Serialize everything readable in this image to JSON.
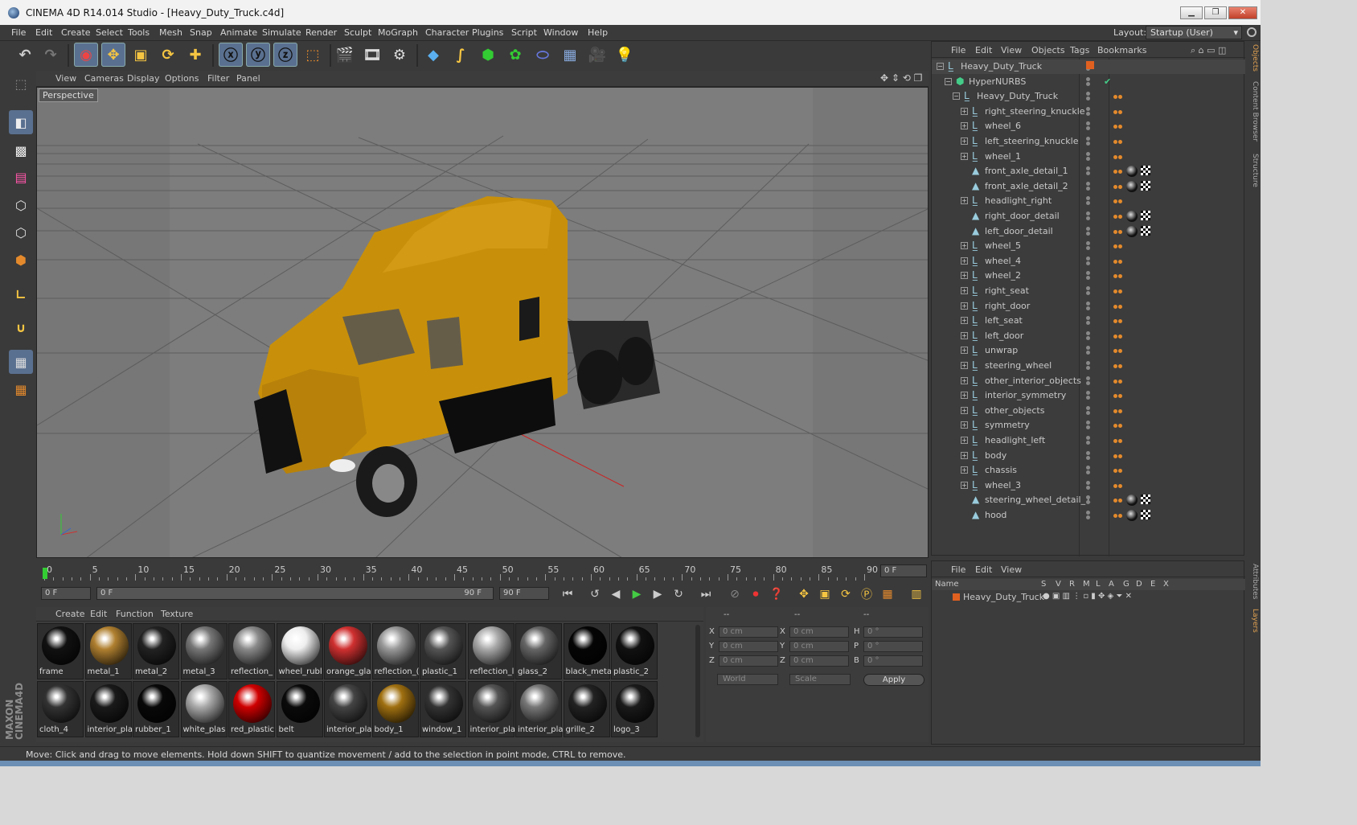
{
  "window": {
    "title": "CINEMA 4D R14.014 Studio - [Heavy_Duty_Truck.c4d]"
  },
  "menubar": [
    "File",
    "Edit",
    "Create",
    "Select",
    "Tools",
    "Mesh",
    "Snap",
    "Animate",
    "Simulate",
    "Render",
    "Sculpt",
    "MoGraph",
    "Character",
    "Plugins",
    "Script",
    "Window",
    "Help"
  ],
  "layout": {
    "label": "Layout:",
    "value": "Startup (User)"
  },
  "viewport": {
    "menu": [
      "View",
      "Cameras",
      "Display",
      "Options",
      "Filter",
      "Panel"
    ],
    "label": "Perspective",
    "background": "#777777",
    "truck_color": "#c8900a"
  },
  "timeline": {
    "ticks": [
      "0",
      "5",
      "10",
      "15",
      "20",
      "25",
      "30",
      "35",
      "40",
      "45",
      "50",
      "55",
      "60",
      "65",
      "70",
      "75",
      "80",
      "85",
      "90"
    ],
    "current_frame": "0 F",
    "start": "0 F",
    "range_start": "0 F",
    "range_end": "90 F",
    "end": "90 F"
  },
  "materials": {
    "menu": [
      "Create",
      "Edit",
      "Function",
      "Texture"
    ],
    "row1": [
      {
        "name": "frame",
        "color": "#111"
      },
      {
        "name": "metal_1",
        "color": "#b08030"
      },
      {
        "name": "metal_2",
        "color": "#222"
      },
      {
        "name": "metal_3",
        "color": "#777"
      },
      {
        "name": "reflection_",
        "color": "#8a8a8a"
      },
      {
        "name": "wheel_rubl",
        "color": "#eee"
      },
      {
        "name": "orange_gla",
        "color": "#d03030"
      },
      {
        "name": "reflection_(",
        "color": "#999"
      },
      {
        "name": "plastic_1",
        "color": "#555"
      },
      {
        "name": "reflection_l",
        "color": "#aaa"
      },
      {
        "name": "glass_2",
        "color": "#666"
      },
      {
        "name": "black_meta",
        "color": "#050505"
      },
      {
        "name": "plastic_2",
        "color": "#111"
      }
    ],
    "row2": [
      {
        "name": "cloth_4",
        "color": "#333"
      },
      {
        "name": "interior_pla",
        "color": "#1a1a1a"
      },
      {
        "name": "rubber_1",
        "color": "#080808"
      },
      {
        "name": "white_plas",
        "color": "#aaa"
      },
      {
        "name": "red_plastic",
        "color": "#d00000"
      },
      {
        "name": "belt",
        "color": "#0a0a0a"
      },
      {
        "name": "interior_pla",
        "color": "#444"
      },
      {
        "name": "body_1",
        "color": "#a07010"
      },
      {
        "name": "window_1",
        "color": "#333"
      },
      {
        "name": "interior_pla",
        "color": "#555"
      },
      {
        "name": "interior_pla",
        "color": "#777"
      },
      {
        "name": "grille_2",
        "color": "#222"
      },
      {
        "name": "logo_3",
        "color": "#1a1a1a"
      }
    ]
  },
  "attributes": {
    "header": [
      "--",
      "--",
      "--"
    ],
    "rows": [
      {
        "a": "X",
        "av": "0 cm",
        "b": "X",
        "bv": "0 cm",
        "c": "H",
        "cv": "0 °"
      },
      {
        "a": "Y",
        "av": "0 cm",
        "b": "Y",
        "bv": "0 cm",
        "c": "P",
        "cv": "0 °"
      },
      {
        "a": "Z",
        "av": "0 cm",
        "b": "Z",
        "bv": "0 cm",
        "c": "B",
        "cv": "0 °"
      }
    ],
    "coord_system": "World",
    "mode": "Scale",
    "apply": "Apply"
  },
  "objects": {
    "menu": [
      "File",
      "Edit",
      "View",
      "Objects",
      "Tags",
      "Bookmarks"
    ],
    "tree": [
      {
        "name": "Heavy_Duty_Truck",
        "level": 0,
        "icon": "null",
        "tag": "root"
      },
      {
        "name": "HyperNURBS",
        "level": 1,
        "icon": "nurbs",
        "tag": "check"
      },
      {
        "name": "Heavy_Duty_Truck",
        "level": 2,
        "icon": "null",
        "tag": "dots"
      },
      {
        "name": "right_steering_knuckle",
        "level": 3,
        "icon": "null",
        "tag": "dots"
      },
      {
        "name": "wheel_6",
        "level": 3,
        "icon": "null",
        "tag": "dots"
      },
      {
        "name": "left_steering_knuckle",
        "level": 3,
        "icon": "null",
        "tag": "dots"
      },
      {
        "name": "wheel_1",
        "level": 3,
        "icon": "null",
        "tag": "dots"
      },
      {
        "name": "front_axle_detail_1",
        "level": 3,
        "icon": "poly",
        "tag": "mat"
      },
      {
        "name": "front_axle_detail_2",
        "level": 3,
        "icon": "poly",
        "tag": "mat"
      },
      {
        "name": "headlight_right",
        "level": 3,
        "icon": "null",
        "tag": "dots"
      },
      {
        "name": "right_door_detail",
        "level": 3,
        "icon": "poly",
        "tag": "mat"
      },
      {
        "name": "left_door_detail",
        "level": 3,
        "icon": "poly",
        "tag": "mat"
      },
      {
        "name": "wheel_5",
        "level": 3,
        "icon": "null",
        "tag": "dots"
      },
      {
        "name": "wheel_4",
        "level": 3,
        "icon": "null",
        "tag": "dots"
      },
      {
        "name": "wheel_2",
        "level": 3,
        "icon": "null",
        "tag": "dots"
      },
      {
        "name": "right_seat",
        "level": 3,
        "icon": "null",
        "tag": "dots"
      },
      {
        "name": "right_door",
        "level": 3,
        "icon": "null",
        "tag": "dots"
      },
      {
        "name": "left_seat",
        "level": 3,
        "icon": "null",
        "tag": "dots"
      },
      {
        "name": "left_door",
        "level": 3,
        "icon": "null",
        "tag": "dots"
      },
      {
        "name": "unwrap",
        "level": 3,
        "icon": "null",
        "tag": "dots"
      },
      {
        "name": "steering_wheel",
        "level": 3,
        "icon": "null",
        "tag": "dots"
      },
      {
        "name": "other_interior_objects",
        "level": 3,
        "icon": "null",
        "tag": "dots"
      },
      {
        "name": "interior_symmetry",
        "level": 3,
        "icon": "null",
        "tag": "dots"
      },
      {
        "name": "other_objects",
        "level": 3,
        "icon": "null",
        "tag": "dots"
      },
      {
        "name": "symmetry",
        "level": 3,
        "icon": "null",
        "tag": "dots"
      },
      {
        "name": "headlight_left",
        "level": 3,
        "icon": "null",
        "tag": "dots"
      },
      {
        "name": "body",
        "level": 3,
        "icon": "null",
        "tag": "dots"
      },
      {
        "name": "chassis",
        "level": 3,
        "icon": "null",
        "tag": "dots"
      },
      {
        "name": "wheel_3",
        "level": 3,
        "icon": "null",
        "tag": "dots"
      },
      {
        "name": "steering_wheel_detail_1",
        "level": 3,
        "icon": "poly",
        "tag": "mat"
      },
      {
        "name": "hood",
        "level": 3,
        "icon": "poly",
        "tag": "mat"
      }
    ]
  },
  "layers": {
    "menu": [
      "File",
      "Edit",
      "View"
    ],
    "columns": [
      "Name",
      "S",
      "V",
      "R",
      "M",
      "L",
      "A",
      "G",
      "D",
      "E",
      "X"
    ],
    "row": "Heavy_Duty_Truck"
  },
  "sidetabs": [
    "Objects",
    "Content Browser",
    "Structure",
    "Attributes",
    "Layers"
  ],
  "status": "Move: Click and drag to move elements. Hold down SHIFT to quantize movement / add to the selection in point mode, CTRL to remove.",
  "colors": {
    "accent": "#e48a2c",
    "selected_tool": "#5a7090",
    "panel": "#3c3c3c"
  }
}
